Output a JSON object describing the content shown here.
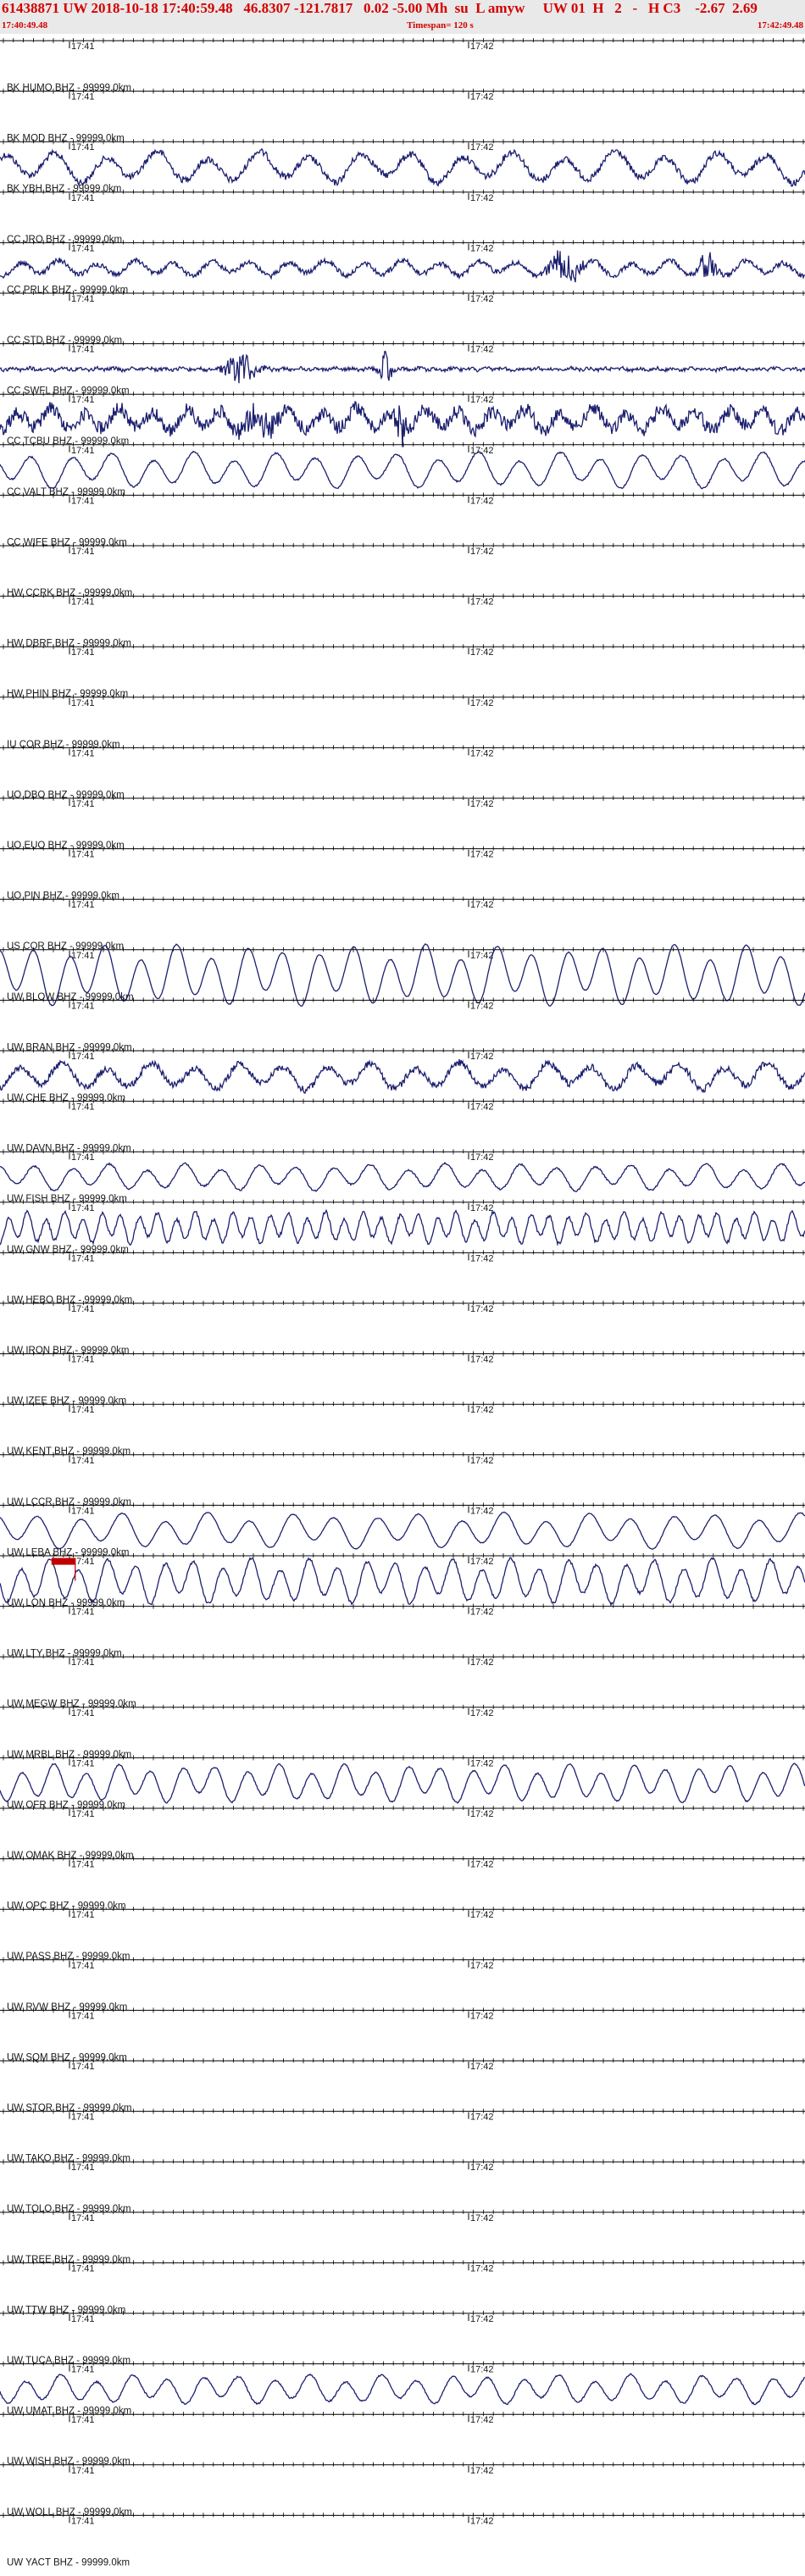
{
  "header": {
    "title": "61438871 UW 2018-10-18 17:40:59.48   46.8307 -121.7817   0.02 -5.00 Mh  su  L amyw     UW 01  H   2   -   H C3    -2.67  2.69",
    "start_time": "17:40:49.48",
    "timespan": "Timespan= 120 s",
    "end_time": "17:42:49.48"
  },
  "time_marks": [
    "17:41",
    "17:42"
  ],
  "colors": {
    "trace": "#1c1f6e",
    "header_text": "#d40000",
    "pick": "#c00000",
    "grid": "#000000"
  },
  "pick_marker": {
    "channel_index": 31,
    "time_fraction": 0.085
  },
  "channels": [
    {
      "label": "BK HUMO BHZ - 99999.0km",
      "signal": false,
      "amp": 0,
      "period": 0,
      "noise": 0
    },
    {
      "label": "BK MOD BHZ - 99999.0km",
      "signal": false,
      "amp": 0,
      "period": 0,
      "noise": 0
    },
    {
      "label": "BK YBH BHZ - 99999.0km",
      "signal": true,
      "amp": 14,
      "period": 60,
      "noise": 4
    },
    {
      "label": "CC JRO BHZ - 99999.0km",
      "signal": false,
      "amp": 0,
      "period": 0,
      "noise": 0
    },
    {
      "label": "CC PRLK BHZ - 99999.0km",
      "signal": true,
      "amp": 7,
      "period": 45,
      "noise": 3,
      "burst": 0.7
    },
    {
      "label": "CC STD BHZ - 99999.0km",
      "signal": false,
      "amp": 0,
      "period": 0,
      "noise": 0
    },
    {
      "label": "CC SWFL BHZ - 99999.0km",
      "signal": true,
      "amp": 1,
      "period": 20,
      "noise": 2,
      "burst": 0.3
    },
    {
      "label": "CC TCBU BHZ - 99999.0km",
      "signal": true,
      "amp": 10,
      "period": 40,
      "noise": 8,
      "burst": 0.32
    },
    {
      "label": "CC VALT BHZ - 99999.0km",
      "signal": true,
      "amp": 16,
      "period": 48,
      "noise": 1
    },
    {
      "label": "CC WIFE BHZ - 99999.0km",
      "signal": false,
      "amp": 0,
      "period": 0,
      "noise": 0
    },
    {
      "label": "HW CCRK BHZ - 99999.0km",
      "signal": false,
      "amp": 0,
      "period": 0,
      "noise": 0
    },
    {
      "label": "HW DBRF BHZ - 99999.0km",
      "signal": false,
      "amp": 0,
      "period": 0,
      "noise": 0
    },
    {
      "label": "HW PHIN BHZ - 99999.0km",
      "signal": false,
      "amp": 0,
      "period": 0,
      "noise": 0
    },
    {
      "label": "IU COR BHZ - 99999.0km",
      "signal": false,
      "amp": 0,
      "period": 0,
      "noise": 0
    },
    {
      "label": "UO DBO BHZ - 99999.0km",
      "signal": false,
      "amp": 0,
      "period": 0,
      "noise": 0
    },
    {
      "label": "UO EUO BHZ - 99999.0km",
      "signal": false,
      "amp": 0,
      "period": 0,
      "noise": 0
    },
    {
      "label": "UO PIN BHZ - 99999.0km",
      "signal": false,
      "amp": 0,
      "period": 0,
      "noise": 0
    },
    {
      "label": "US COR BHZ - 99999.0km",
      "signal": false,
      "amp": 0,
      "period": 0,
      "noise": 0
    },
    {
      "label": "UW BLOW BHZ - 99999.0km",
      "signal": true,
      "amp": 27,
      "period": 42,
      "noise": 0.5
    },
    {
      "label": "UW BRAN BHZ - 99999.0km",
      "signal": false,
      "amp": 0,
      "period": 0,
      "noise": 0
    },
    {
      "label": "UW CHE BHZ - 99999.0km",
      "signal": true,
      "amp": 12,
      "period": 52,
      "noise": 4
    },
    {
      "label": "UW DAVN BHZ - 99999.0km",
      "signal": false,
      "amp": 0,
      "period": 0,
      "noise": 0
    },
    {
      "label": "UW FISH BHZ - 99999.0km",
      "signal": true,
      "amp": 12,
      "period": 44,
      "noise": 1
    },
    {
      "label": "UW GNW BHZ - 99999.0km",
      "signal": true,
      "amp": 14,
      "period": 22,
      "noise": 2
    },
    {
      "label": "UW HEBO BHZ - 99999.0km",
      "signal": false,
      "amp": 0,
      "period": 0,
      "noise": 0
    },
    {
      "label": "UW IRON BHZ - 99999.0km",
      "signal": false,
      "amp": 0,
      "period": 0,
      "noise": 0
    },
    {
      "label": "UW IZEE BHZ - 99999.0km",
      "signal": false,
      "amp": 0,
      "period": 0,
      "noise": 0
    },
    {
      "label": "UW KENT BHZ - 99999.0km",
      "signal": false,
      "amp": 0,
      "period": 0,
      "noise": 0
    },
    {
      "label": "UW LCCR BHZ - 99999.0km",
      "signal": false,
      "amp": 0,
      "period": 0,
      "noise": 0
    },
    {
      "label": "UW LEBA BHZ - 99999.0km",
      "signal": true,
      "amp": 16,
      "period": 50,
      "noise": 0.5
    },
    {
      "label": "UW LON BHZ - 99999.0km",
      "signal": true,
      "amp": 20,
      "period": 34,
      "noise": 1.5
    },
    {
      "label": "UW LTY BHZ - 99999.0km",
      "signal": false,
      "amp": 0,
      "period": 0,
      "noise": 0
    },
    {
      "label": "UW MEGW BHZ - 99999.0km",
      "signal": false,
      "amp": 0,
      "period": 0,
      "noise": 0
    },
    {
      "label": "UW MRBL BHZ - 99999.0km",
      "signal": false,
      "amp": 0,
      "period": 0,
      "noise": 0
    },
    {
      "label": "UW OFR BHZ - 99999.0km",
      "signal": true,
      "amp": 17,
      "period": 38,
      "noise": 0.8
    },
    {
      "label": "UW OMAK BHZ - 99999.0km",
      "signal": false,
      "amp": 0,
      "period": 0,
      "noise": 0
    },
    {
      "label": "UW OPC BHZ - 99999.0km",
      "signal": false,
      "amp": 0,
      "period": 0,
      "noise": 0
    },
    {
      "label": "UW PASS BHZ - 99999.0km",
      "signal": false,
      "amp": 0,
      "period": 0,
      "noise": 0
    },
    {
      "label": "UW RVW BHZ - 99999.0km",
      "signal": false,
      "amp": 0,
      "period": 0,
      "noise": 0
    },
    {
      "label": "UW SQM BHZ - 99999.0km",
      "signal": false,
      "amp": 0,
      "period": 0,
      "noise": 0
    },
    {
      "label": "UW STOR BHZ - 99999.0km",
      "signal": false,
      "amp": 0,
      "period": 0,
      "noise": 0
    },
    {
      "label": "UW TAKO BHZ - 99999.0km",
      "signal": false,
      "amp": 0,
      "period": 0,
      "noise": 0
    },
    {
      "label": "UW TOLO BHZ - 99999.0km",
      "signal": false,
      "amp": 0,
      "period": 0,
      "noise": 0
    },
    {
      "label": "UW TREE BHZ - 99999.0km",
      "signal": false,
      "amp": 0,
      "period": 0,
      "noise": 0
    },
    {
      "label": "UW TTW BHZ - 99999.0km",
      "signal": false,
      "amp": 0,
      "period": 0,
      "noise": 0
    },
    {
      "label": "UW TUCA BHZ - 99999.0km",
      "signal": false,
      "amp": 0,
      "period": 0,
      "noise": 0
    },
    {
      "label": "UW UMAT BHZ - 99999.0km",
      "signal": true,
      "amp": 13,
      "period": 42,
      "noise": 1
    },
    {
      "label": "UW WISH BHZ - 99999.0km",
      "signal": false,
      "amp": 0,
      "period": 0,
      "noise": 0
    },
    {
      "label": "UW WOLL BHZ - 99999.0km",
      "signal": false,
      "amp": 0,
      "period": 0,
      "noise": 0
    },
    {
      "label": "UW YACT BHZ - 99999.0km",
      "signal": false,
      "amp": 0,
      "period": 0,
      "noise": 0
    }
  ]
}
